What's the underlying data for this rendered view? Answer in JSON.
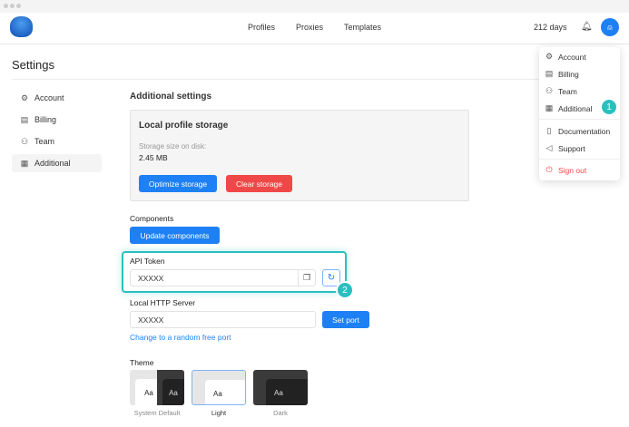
{
  "header": {
    "nav": [
      "Profiles",
      "Proxies",
      "Templates"
    ],
    "days_left": "212 days"
  },
  "page": {
    "title": "Settings"
  },
  "sidebar": {
    "items": [
      {
        "label": "Account",
        "icon": "gear-icon"
      },
      {
        "label": "Billing",
        "icon": "receipt-icon"
      },
      {
        "label": "Team",
        "icon": "users-icon"
      },
      {
        "label": "Additional",
        "icon": "grid-icon"
      }
    ]
  },
  "main": {
    "heading": "Additional settings",
    "storage": {
      "title": "Local profile storage",
      "size_label": "Storage size on disk:",
      "size_value": "2.45 MB",
      "optimize": "Optimize storage",
      "clear": "Clear storage"
    },
    "components": {
      "label": "Components",
      "button": "Update components"
    },
    "api": {
      "label": "API Token",
      "value": "XXXXX"
    },
    "http": {
      "label": "Local HTTP Server",
      "value": "XXXXX",
      "button": "Set port",
      "link": "Change to a random free port"
    },
    "theme": {
      "label": "Theme",
      "options": [
        {
          "label": "System Default",
          "sample": "Aa"
        },
        {
          "label": "Light",
          "sample": "Aa"
        },
        {
          "label": "Dark",
          "sample": "Aa"
        }
      ],
      "selected": "Light"
    }
  },
  "menu": {
    "items": [
      "Account",
      "Billing",
      "Team",
      "Additional"
    ],
    "links": [
      "Documentation",
      "Support"
    ],
    "signout": "Sign out"
  },
  "annotations": {
    "one": "1",
    "two": "2"
  },
  "colors": {
    "accent": "#1e80f5",
    "danger": "#f04848",
    "highlight": "#2bbfbf"
  }
}
